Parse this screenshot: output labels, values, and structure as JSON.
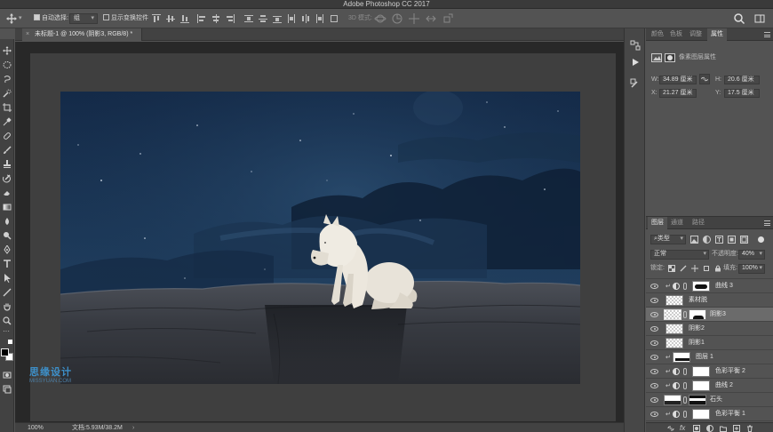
{
  "window": {
    "title": "Adobe Photoshop CC 2017"
  },
  "options_bar": {
    "auto_select_label": "自动选择:",
    "auto_select_value": "组",
    "show_transform_label": "显示变换控件",
    "mode_3d_label": "3D 模式:"
  },
  "document": {
    "tab_title": "未标题-1 @ 100% (阴影3, RGB/8) *",
    "close_glyph": "×"
  },
  "status_bar": {
    "zoom": "100%",
    "doc_info": "文档:5.93M/38.2M"
  },
  "watermark": {
    "line1": "思缘设计",
    "line2": "MISSYUAN.COM"
  },
  "properties_panel": {
    "tabs": [
      "颜色",
      "色板",
      "调整",
      "属性"
    ],
    "active_tab": "属性",
    "header_label": "像素图层属性",
    "w_label": "W:",
    "w_value": "34.89 厘米",
    "h_label": "H:",
    "h_value": "20.6 厘米",
    "x_label": "X:",
    "x_value": "21.27 厘米",
    "y_label": "Y:",
    "y_value": "17.5 厘米"
  },
  "layers_panel": {
    "tabs": [
      "图层",
      "通道",
      "路径"
    ],
    "active_tab": "图层",
    "filter_kind": "类型",
    "blend_mode": "正常",
    "opacity_label": "不透明度:",
    "opacity_value": "40%",
    "lock_label": "锁定:",
    "fill_label": "填充:",
    "fill_value": "100%",
    "layers": [
      {
        "name": "曲线 3",
        "type": "curves",
        "clipped": true,
        "mask": "dark-mask",
        "selected": false
      },
      {
        "name": "素材脱",
        "type": "pixel",
        "clipped": false,
        "selected": false
      },
      {
        "name": "阴影3",
        "type": "pixel-mask",
        "clipped": false,
        "selected": true
      },
      {
        "name": "阴影2",
        "type": "pixel",
        "clipped": false,
        "selected": false
      },
      {
        "name": "阴影1",
        "type": "pixel",
        "clipped": false,
        "selected": false
      },
      {
        "name": "图层 1",
        "type": "pixel-clipped",
        "clipped": true,
        "selected": false
      },
      {
        "name": "色彩平衡 2",
        "type": "adjustment",
        "clipped": true,
        "selected": false
      },
      {
        "name": "曲线 2",
        "type": "adjustment",
        "clipped": true,
        "selected": false
      },
      {
        "name": "石头",
        "type": "pixel-mask",
        "clipped": false,
        "selected": false
      },
      {
        "name": "色彩平衡 1",
        "type": "adjustment",
        "clipped": true,
        "selected": false
      }
    ]
  },
  "colors": {
    "panel_bg": "#535353",
    "dark_bg": "#282828",
    "sky_top": "#152b4a",
    "sky_bottom": "#2b4a6a",
    "rock": "#3a3d44",
    "wolf": "#e6e1d6"
  }
}
